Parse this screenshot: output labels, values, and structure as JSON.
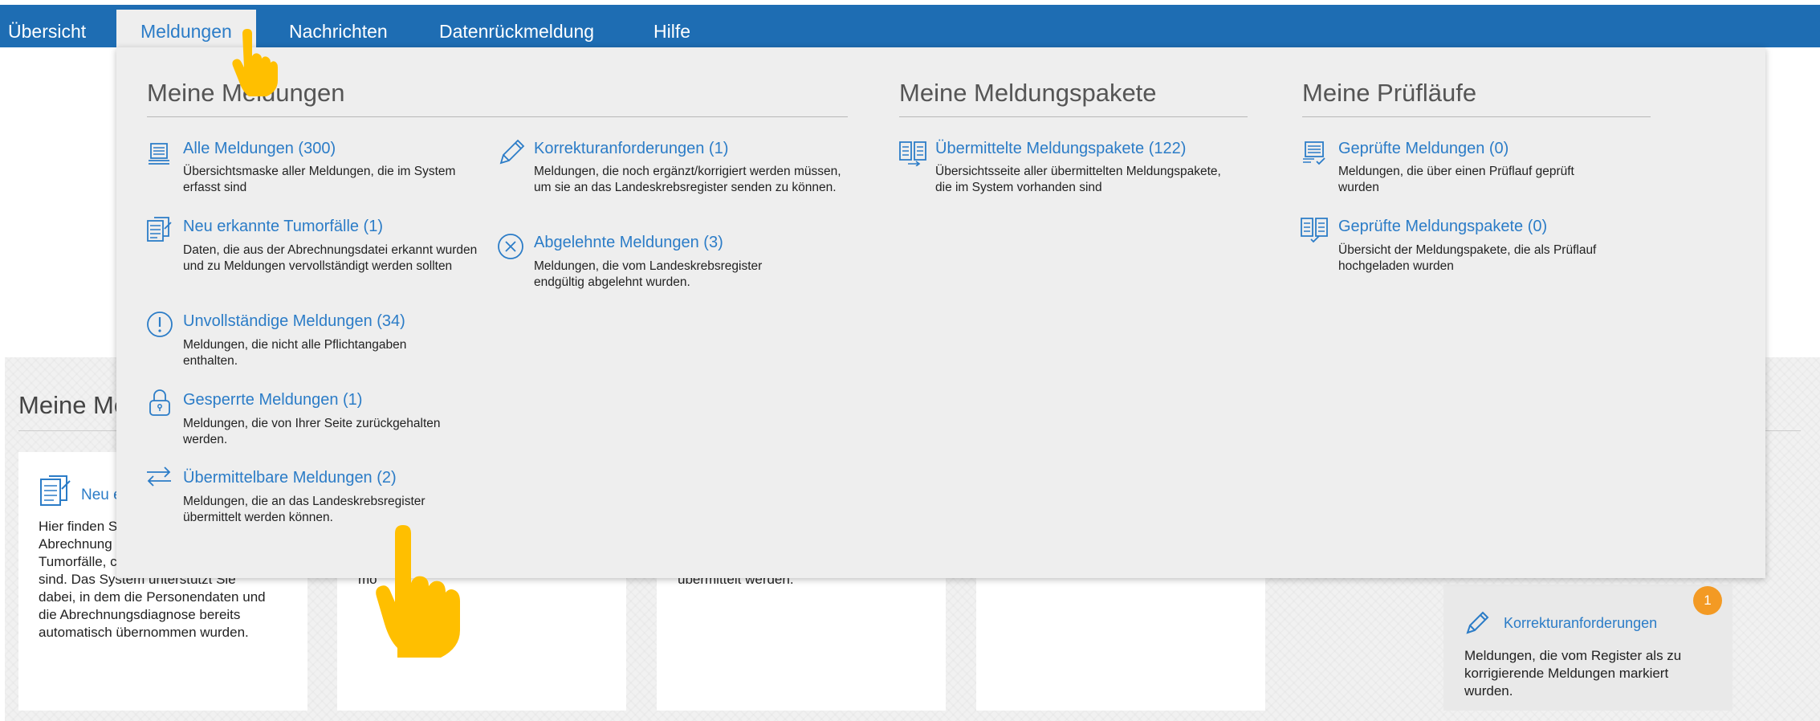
{
  "nav": {
    "tabs": [
      {
        "label": "Übersicht"
      },
      {
        "label": "Meldungen",
        "active": true
      },
      {
        "label": "Nachrichten"
      },
      {
        "label": "Datenrückmeldung"
      },
      {
        "label": "Hilfe"
      }
    ]
  },
  "menu": {
    "col1": {
      "heading": "Meine Meldungen",
      "items": [
        {
          "label": "Alle Meldungen (300)",
          "desc": "Übersichtsmaske aller Meldungen, die im System erfasst sind",
          "icon": "list-document-icon"
        },
        {
          "label": "Neu erkannte Tumorfälle (1)",
          "desc": "Daten, die aus der Abrechnungsdatei erkannt wurden und zu Meldungen vervollständigt werden sollten",
          "icon": "new-document-icon"
        },
        {
          "label": "Unvollständige Meldungen (34)",
          "desc": "Meldungen, die nicht alle Pflichtangaben enthalten.",
          "icon": "exclamation-circle-icon"
        },
        {
          "label": "Gesperrte Meldungen (1)",
          "desc": "Meldungen, die von Ihrer Seite zurückgehalten werden.",
          "icon": "lock-icon"
        },
        {
          "label": "Übermittelbare Meldungen (2)",
          "desc": "Meldungen, die an das Landeskrebsregister übermittelt werden können.",
          "icon": "transfer-arrows-icon"
        }
      ]
    },
    "col2": {
      "items": [
        {
          "label": "Korrekturanforderungen (1)",
          "desc": "Meldungen, die noch ergänzt/korrigiert werden müssen, um sie an das Landeskrebsregister senden zu können.",
          "icon": "pencil-icon"
        },
        {
          "label": "Abgelehnte Meldungen (3)",
          "desc": "Meldungen, die vom Landeskrebsregister endgültig abgelehnt wurden.",
          "icon": "x-circle-icon"
        }
      ]
    },
    "col3": {
      "heading": "Meine Meldungspakete",
      "items": [
        {
          "label": "Übermittelte Meldungspakete (122)",
          "desc": "Übersichtsseite aller übermittelten Meldungspakete, die im System vorhanden sind",
          "icon": "package-sent-icon"
        }
      ]
    },
    "col4": {
      "heading": "Meine Prüfläufe",
      "items": [
        {
          "label": "Geprüfte Meldungen (0)",
          "desc": "Meldungen, die über einen Prüflauf geprüft wurden",
          "icon": "checked-document-icon"
        },
        {
          "label": "Geprüfte Meldungspakete (0)",
          "desc": "Übersicht der Meldungspakete, die als Prüflauf hochgeladen wurden",
          "icon": "checked-package-icon"
        }
      ]
    }
  },
  "dashboard": {
    "title_partial": "Meine Me",
    "card1": {
      "link_partial": "Neu e",
      "text_l1": "Hier finden S",
      "text_l2": "Abrechnung",
      "text_l3": "Tumorfälle, c",
      "text_l4": "sind. Das System unterstützt Sie",
      "text_l5": "dabei, in dem die Personendaten und",
      "text_l6": "die Abrechnungsdiagnose bereits",
      "text_l7": "automatisch übernommen wurden."
    },
    "card2": {
      "text_partial": "mö"
    },
    "card3": {
      "text_partial": "übermittelt werden."
    },
    "card_korrektur": {
      "badge": "1",
      "link": "Korrekturanforderungen",
      "text": "Meldungen, die vom Register als zu korrigierende Meldungen markiert wurden."
    }
  },
  "colors": {
    "nav_blue": "#1e6db3",
    "link_blue": "#2b7cc7",
    "badge_orange": "#f39a24",
    "hand_yellow": "#ffbf00"
  }
}
